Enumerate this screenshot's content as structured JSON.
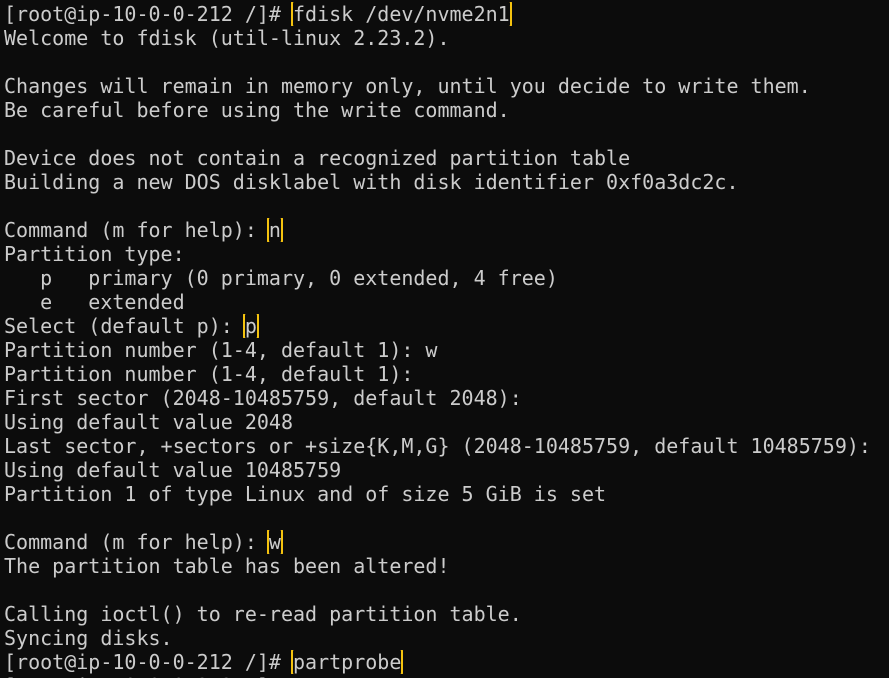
{
  "terminal": {
    "prompt": "[root@ip-10-0-0-212 /]# ",
    "cmd_fdisk": "fdisk /dev/nvme2n1",
    "welcome": "Welcome to fdisk (util-linux 2.23.2).",
    "changes_note": "Changes will remain in memory only, until you decide to write them.",
    "careful_note": "Be careful before using the write command.",
    "no_table": "Device does not contain a recognized partition table",
    "building": "Building a new DOS disklabel with disk identifier 0xf0a3dc2c.",
    "command_prompt": "Command (m for help): ",
    "input_n": "n",
    "partition_type": "Partition type:",
    "opt_primary": "   p   primary (0 primary, 0 extended, 4 free)",
    "opt_extended": "   e   extended",
    "select_prompt": "Select (default p): ",
    "input_p": "p",
    "part_number_w": "Partition number (1-4, default 1): w",
    "part_number": "Partition number (1-4, default 1):",
    "first_sector": "First sector (2048-10485759, default 2048):",
    "default_2048": "Using default value 2048",
    "last_sector": "Last sector, +sectors or +size{K,M,G} (2048-10485759, default 10485759):",
    "default_last": "Using default value 10485759",
    "part_set": "Partition 1 of type Linux and of size 5 GiB is set",
    "input_w": "w",
    "altered": "The partition table has been altered!",
    "ioctl": "Calling ioctl() to re-read partition table.",
    "syncing": "Syncing disks.",
    "cmd_partprobe": "partprobe"
  },
  "colors": {
    "background": "#0c0c0c",
    "text": "#cccccc",
    "highlight": "#f5c30f"
  }
}
